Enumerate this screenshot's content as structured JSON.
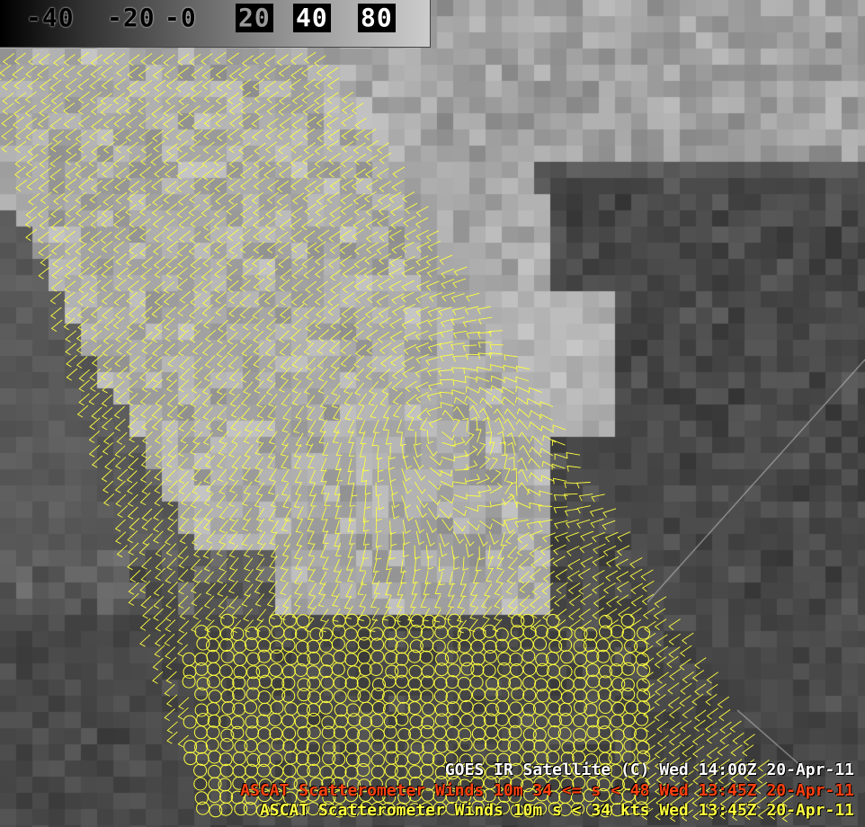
{
  "colorbar": {
    "labels": [
      "-40",
      "-20",
      "-0",
      "20",
      "40",
      "80"
    ]
  },
  "captions": {
    "satellite": "GOES IR Satellite (C)  Wed 14:00Z 20-Apr-11",
    "ascat_high": "ASCAT Scatterometer Winds 10m 34 <= s < 48  Wed 13:45Z 20-Apr-11",
    "ascat_low": "ASCAT Scatterometer Winds 10m s < 34 kts  Wed 13:45Z 20-Apr-11"
  },
  "colors": {
    "ascat_low": "#ffff40",
    "ascat_high": "#ff4010",
    "caption_white": "#ffffff"
  },
  "icons": {
    "wind_barb": "wind-barb-icon",
    "calm_circle": "calm-circle-icon"
  }
}
